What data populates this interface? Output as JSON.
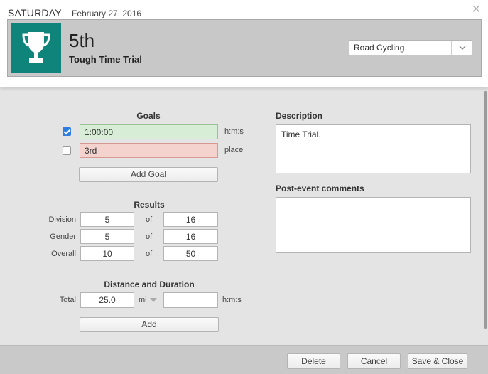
{
  "header": {
    "day": "SATURDAY",
    "date": "February 27, 2016",
    "place": "5th",
    "event_name": "Tough Time Trial",
    "sport": "Road Cycling",
    "trophy_color": "#0e847a"
  },
  "goals": {
    "title": "Goals",
    "items": [
      {
        "value": "1:00:00",
        "unit": "h:m:s",
        "checked": true
      },
      {
        "value": "3rd",
        "unit": "place",
        "checked": false
      }
    ],
    "add_label": "Add Goal"
  },
  "results": {
    "title": "Results",
    "of_label": "of",
    "rows": [
      {
        "label": "Division",
        "value": "5",
        "total": "16"
      },
      {
        "label": "Gender",
        "value": "5",
        "total": "16"
      },
      {
        "label": "Overall",
        "value": "10",
        "total": "50"
      }
    ]
  },
  "distance": {
    "title": "Distance and Duration",
    "label": "Total",
    "value": "25.0",
    "unit": "mi",
    "duration": "",
    "duration_unit": "h:m:s",
    "add_label": "Add"
  },
  "description": {
    "title": "Description",
    "value": "Time Trial."
  },
  "comments": {
    "title": "Post-event comments",
    "value": ""
  },
  "footer": {
    "delete_label": "Delete",
    "cancel_label": "Cancel",
    "save_label": "Save & Close"
  }
}
